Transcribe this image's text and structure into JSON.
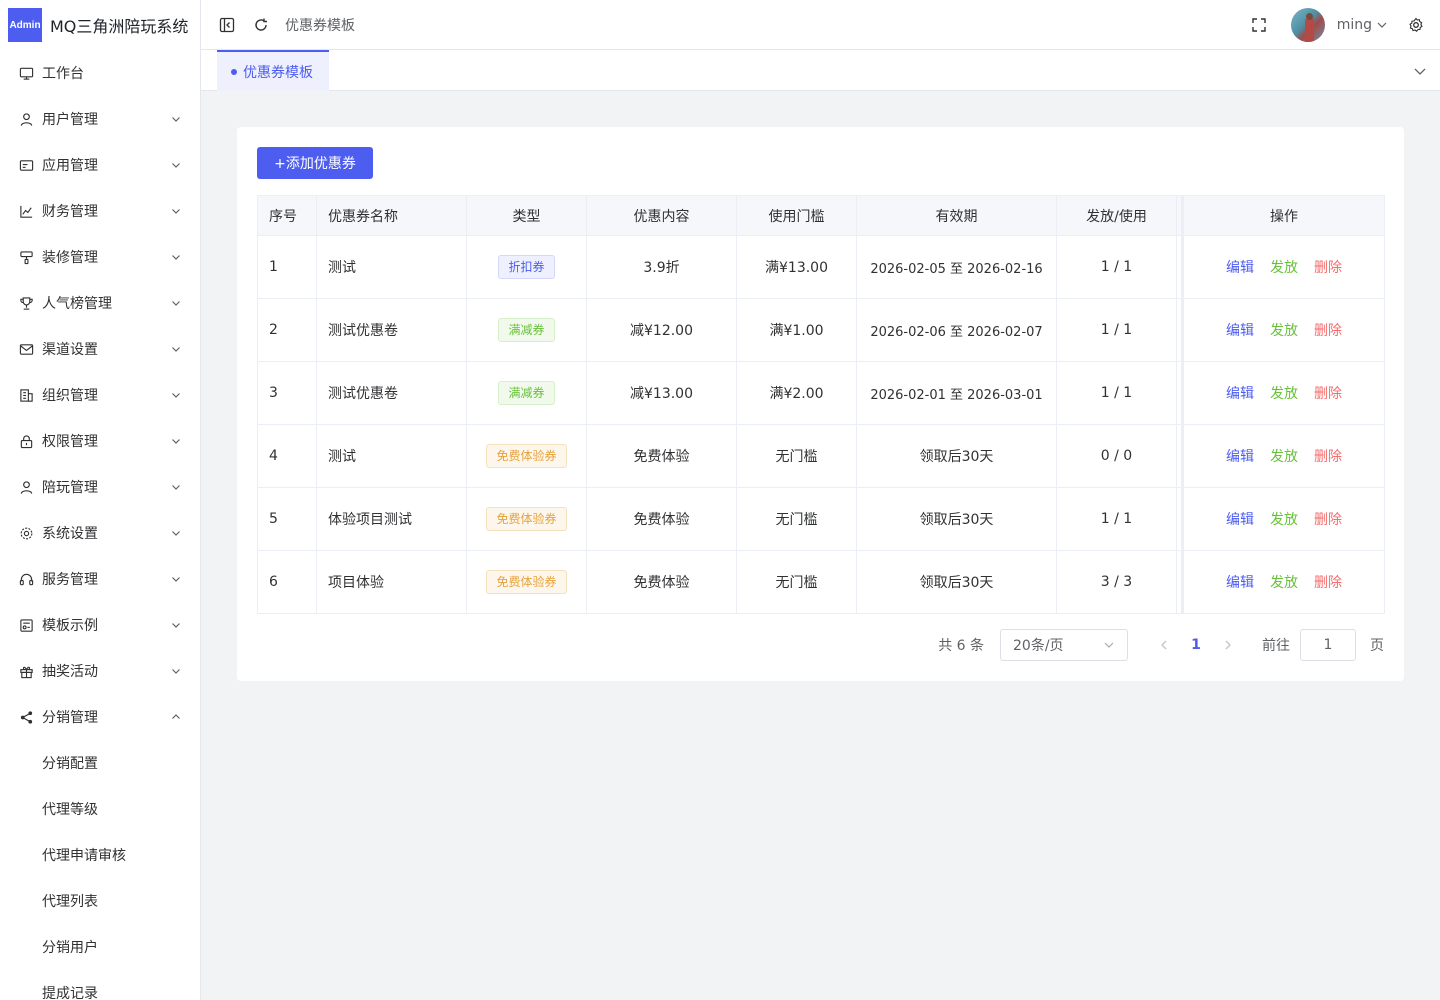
{
  "app": {
    "badge": "Admin",
    "title": "MQ三角洲陪玩系统"
  },
  "sidebar": {
    "items": [
      {
        "label": "工作台",
        "icon": "monitor-icon",
        "arrow": ""
      },
      {
        "label": "用户管理",
        "icon": "user-icon",
        "arrow": "down"
      },
      {
        "label": "应用管理",
        "icon": "app-card-icon",
        "arrow": "down"
      },
      {
        "label": "财务管理",
        "icon": "chart-icon",
        "arrow": "down"
      },
      {
        "label": "装修管理",
        "icon": "brush-icon",
        "arrow": "down"
      },
      {
        "label": "人气榜管理",
        "icon": "trophy-icon",
        "arrow": "down"
      },
      {
        "label": "渠道设置",
        "icon": "mail-icon",
        "arrow": "down"
      },
      {
        "label": "组织管理",
        "icon": "building-icon",
        "arrow": "down"
      },
      {
        "label": "权限管理",
        "icon": "lock-icon",
        "arrow": "down"
      },
      {
        "label": "陪玩管理",
        "icon": "user-icon",
        "arrow": "down"
      },
      {
        "label": "系统设置",
        "icon": "gear-icon",
        "arrow": "down"
      },
      {
        "label": "服务管理",
        "icon": "headset-icon",
        "arrow": "down"
      },
      {
        "label": "模板示例",
        "icon": "template-icon",
        "arrow": "down"
      },
      {
        "label": "抽奖活动",
        "icon": "gift-icon",
        "arrow": "down"
      },
      {
        "label": "分销管理",
        "icon": "share-icon",
        "arrow": "up"
      }
    ],
    "subitems": [
      "分销配置",
      "代理等级",
      "代理申请审核",
      "代理列表",
      "分销用户",
      "提成记录"
    ]
  },
  "header": {
    "breadcrumb": "优惠券模板",
    "username": "ming"
  },
  "tabs": [
    {
      "label": "优惠券模板",
      "active": true
    }
  ],
  "toolbar": {
    "add_label": "+添加优惠券"
  },
  "table": {
    "columns": [
      "序号",
      "优惠券名称",
      "类型",
      "优惠内容",
      "使用门槛",
      "有效期",
      "发放/使用",
      "操作"
    ],
    "rows": [
      {
        "no": "1",
        "name": "测试",
        "type": "折扣券",
        "type_color": "blue",
        "content": "3.9折",
        "threshold": "满¥13.00",
        "threshold_muted": false,
        "validity": "2026-02-05 至 2026-02-16",
        "validity_small": true,
        "usage": "1 / 1"
      },
      {
        "no": "2",
        "name": "测试优惠卷",
        "type": "满减券",
        "type_color": "green",
        "content": "减¥12.00",
        "threshold": "满¥1.00",
        "threshold_muted": false,
        "validity": "2026-02-06 至 2026-02-07",
        "validity_small": true,
        "usage": "1 / 1"
      },
      {
        "no": "3",
        "name": "测试优惠卷",
        "type": "满减券",
        "type_color": "green",
        "content": "减¥13.00",
        "threshold": "满¥2.00",
        "threshold_muted": false,
        "validity": "2026-02-01 至 2026-03-01",
        "validity_small": true,
        "usage": "1 / 1"
      },
      {
        "no": "4",
        "name": "测试",
        "type": "免费体验券",
        "type_color": "orange",
        "content": "免费体验",
        "threshold": "无门槛",
        "threshold_muted": true,
        "validity": "领取后30天",
        "validity_small": false,
        "usage": "0 / 0"
      },
      {
        "no": "5",
        "name": "体验项目测试",
        "type": "免费体验券",
        "type_color": "orange",
        "content": "免费体验",
        "threshold": "无门槛",
        "threshold_muted": true,
        "validity": "领取后30天",
        "validity_small": false,
        "usage": "1 / 1"
      },
      {
        "no": "6",
        "name": "项目体验",
        "type": "免费体验券",
        "type_color": "orange",
        "content": "免费体验",
        "threshold": "无门槛",
        "threshold_muted": true,
        "validity": "领取后30天",
        "validity_small": false,
        "usage": "3 / 3"
      }
    ],
    "actions": {
      "edit": "编辑",
      "send": "发放",
      "delete": "删除"
    }
  },
  "pagination": {
    "total": "共 6 条",
    "page_size": "20条/页",
    "current": "1",
    "goto_label": "前往",
    "goto_value": "1",
    "goto_unit": "页"
  },
  "colors": {
    "accent": "#4c5df0",
    "success": "#67c23a",
    "danger": "#f56c6c",
    "warning": "#e6a23c"
  }
}
